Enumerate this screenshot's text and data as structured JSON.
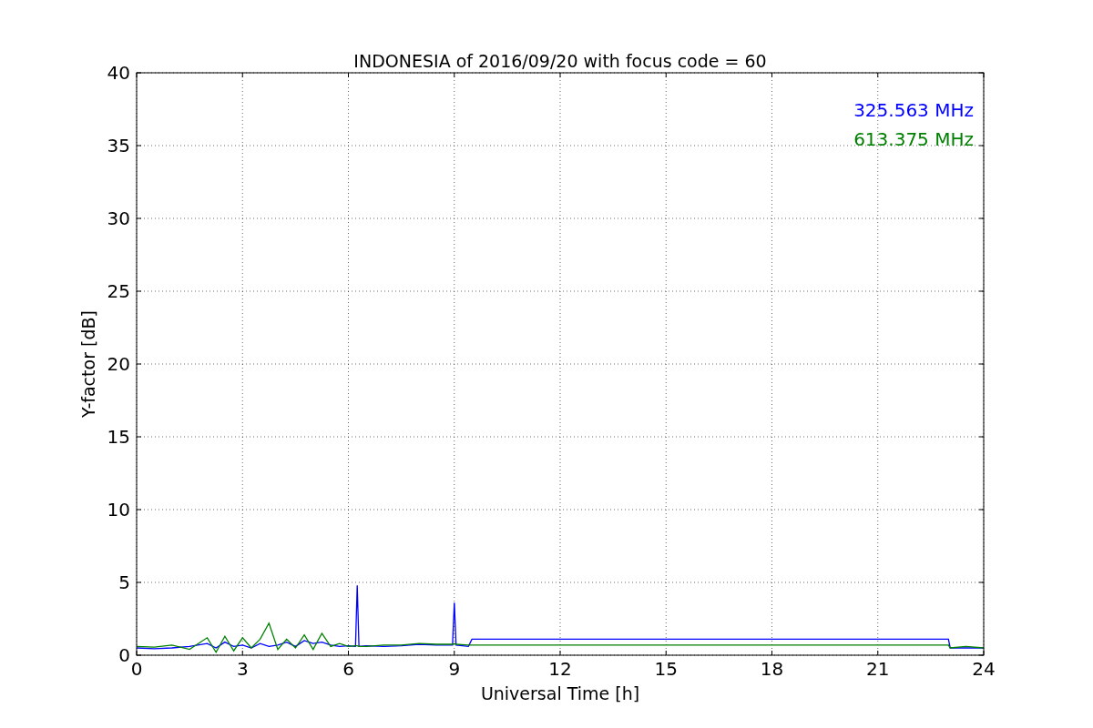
{
  "chart_data": {
    "type": "line",
    "title": "INDONESIA of 2016/09/20 with focus code = 60",
    "xlabel": "Universal Time [h]",
    "ylabel": "Y-factor [dB]",
    "x": [
      0,
      0.5,
      1,
      1.5,
      2,
      2.25,
      2.5,
      2.75,
      3,
      3.25,
      3.5,
      3.75,
      4,
      4.25,
      4.5,
      4.75,
      5,
      5.25,
      5.5,
      5.75,
      6,
      6.2,
      6.25,
      6.3,
      6.5,
      7,
      7.5,
      8,
      8.5,
      8.95,
      9,
      9.05,
      9.4,
      9.5,
      12,
      15,
      18,
      21,
      23,
      23.05,
      23.5,
      24
    ],
    "series": [
      {
        "name": "325.563 MHz",
        "color": "#0000ff",
        "values": [
          0.5,
          0.45,
          0.5,
          0.6,
          0.8,
          0.5,
          0.9,
          0.6,
          0.7,
          0.5,
          0.8,
          0.6,
          0.7,
          0.9,
          0.6,
          1.0,
          0.8,
          0.9,
          0.7,
          0.6,
          0.65,
          0.6,
          4.8,
          0.6,
          0.65,
          0.6,
          0.65,
          0.75,
          0.7,
          0.7,
          3.6,
          0.7,
          0.6,
          1.1,
          1.1,
          1.1,
          1.1,
          1.1,
          1.1,
          0.5,
          0.5,
          0.5
        ]
      },
      {
        "name": "613.375 MHz",
        "color": "#008000",
        "values": [
          0.6,
          0.55,
          0.7,
          0.4,
          1.2,
          0.2,
          1.3,
          0.3,
          1.2,
          0.5,
          1.1,
          2.2,
          0.4,
          1.1,
          0.5,
          1.4,
          0.4,
          1.5,
          0.6,
          0.8,
          0.6,
          0.65,
          0.65,
          0.6,
          0.6,
          0.7,
          0.7,
          0.8,
          0.75,
          0.75,
          0.8,
          0.75,
          0.7,
          0.7,
          0.7,
          0.7,
          0.7,
          0.7,
          0.7,
          0.5,
          0.6,
          0.5
        ]
      }
    ],
    "grid": true,
    "xlim": [
      0,
      24
    ],
    "ylim": [
      0,
      40
    ],
    "xticks": [
      0,
      3,
      6,
      9,
      12,
      15,
      18,
      21,
      24
    ],
    "yticks": [
      0,
      5,
      10,
      15,
      20,
      25,
      30,
      35,
      40
    ]
  }
}
